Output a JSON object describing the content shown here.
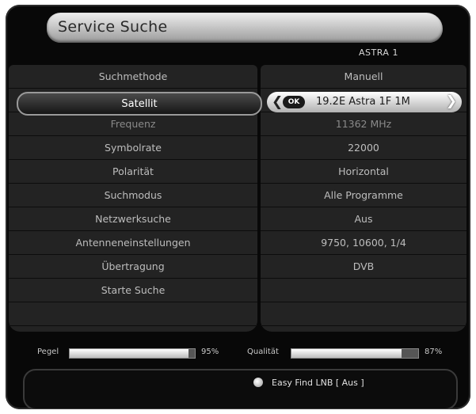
{
  "header": {
    "title": "Service Suche",
    "satellite": "ASTRA 1"
  },
  "menu": [
    {
      "label": "Suchmethode",
      "value": "Manuell"
    },
    {
      "label": "Satellit",
      "value": "19.2E Astra 1F 1M"
    },
    {
      "label": "Frequenz",
      "value": "11362 MHz"
    },
    {
      "label": "Symbolrate",
      "value": "22000"
    },
    {
      "label": "Polarität",
      "value": "Horizontal"
    },
    {
      "label": "Suchmodus",
      "value": "Alle Programme"
    },
    {
      "label": "Netzwerksuche",
      "value": "Aus"
    },
    {
      "label": "Antenneneinstellungen",
      "value": "9750, 10600, 1/4"
    },
    {
      "label": "Übertragung",
      "value": "DVB"
    },
    {
      "label": "Starte Suche",
      "value": ""
    }
  ],
  "selector": {
    "ok_label": "OK"
  },
  "signal": {
    "level_label": "Pegel",
    "level_percent": 95,
    "level_text": "95%",
    "quality_label": "Qualität",
    "quality_percent": 87,
    "quality_text": "87%"
  },
  "footer": {
    "easy_find": "Easy Find LNB [ Aus ]"
  }
}
